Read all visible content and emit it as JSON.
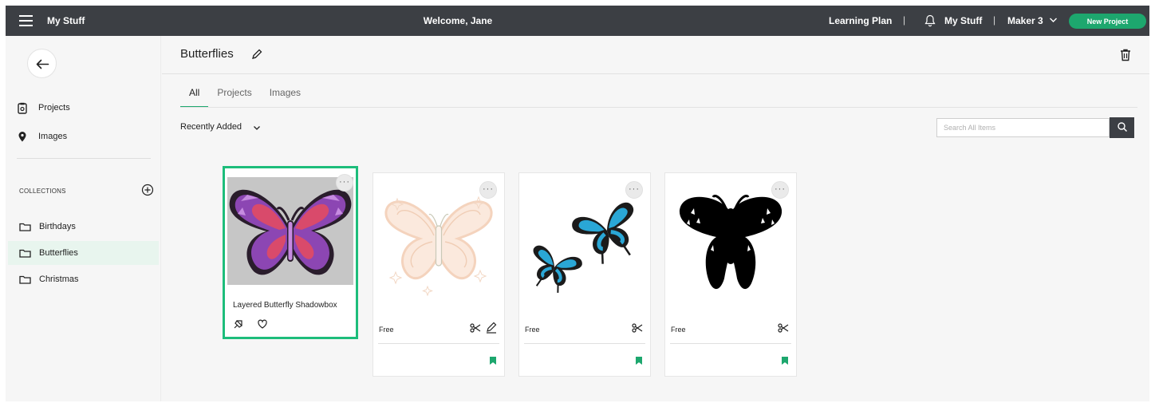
{
  "topbar": {
    "brand": "My Stuff",
    "welcome": "Welcome, Jane",
    "learning_plan": "Learning Plan",
    "separator": "|",
    "my_stuff": "My Stuff",
    "machine": "Maker 3",
    "new_project": "New Project"
  },
  "sidebar": {
    "nav": [
      {
        "label": "Projects",
        "icon": "projects-icon"
      },
      {
        "label": "Images",
        "icon": "images-icon"
      }
    ],
    "collections_label": "COLLECTIONS",
    "collections": [
      {
        "label": "Birthdays",
        "active": false
      },
      {
        "label": "Butterflies",
        "active": true
      },
      {
        "label": "Christmas",
        "active": false
      }
    ]
  },
  "main": {
    "title": "Butterflies",
    "tabs": [
      {
        "label": "All",
        "active": true
      },
      {
        "label": "Projects",
        "active": false
      },
      {
        "label": "Images",
        "active": false
      }
    ],
    "sort_label": "Recently Added",
    "search_placeholder": "Search All Items",
    "more_label": "···",
    "cards": [
      {
        "title": "Layered Butterfly Shadowbox",
        "type": "project",
        "selected": true
      },
      {
        "price": "Free",
        "type": "image",
        "actions": [
          "cut-icon",
          "draw-icon"
        ],
        "saved": true
      },
      {
        "price": "Free",
        "type": "image",
        "actions": [
          "cut-icon"
        ],
        "saved": true
      },
      {
        "price": "Free",
        "type": "image",
        "actions": [
          "cut-icon"
        ],
        "saved": true
      }
    ]
  },
  "colors": {
    "topbar": "#3c3f44",
    "accent": "#1da76e",
    "selected_border": "#1dbd7b",
    "active_collection": "#e8f5ee"
  }
}
